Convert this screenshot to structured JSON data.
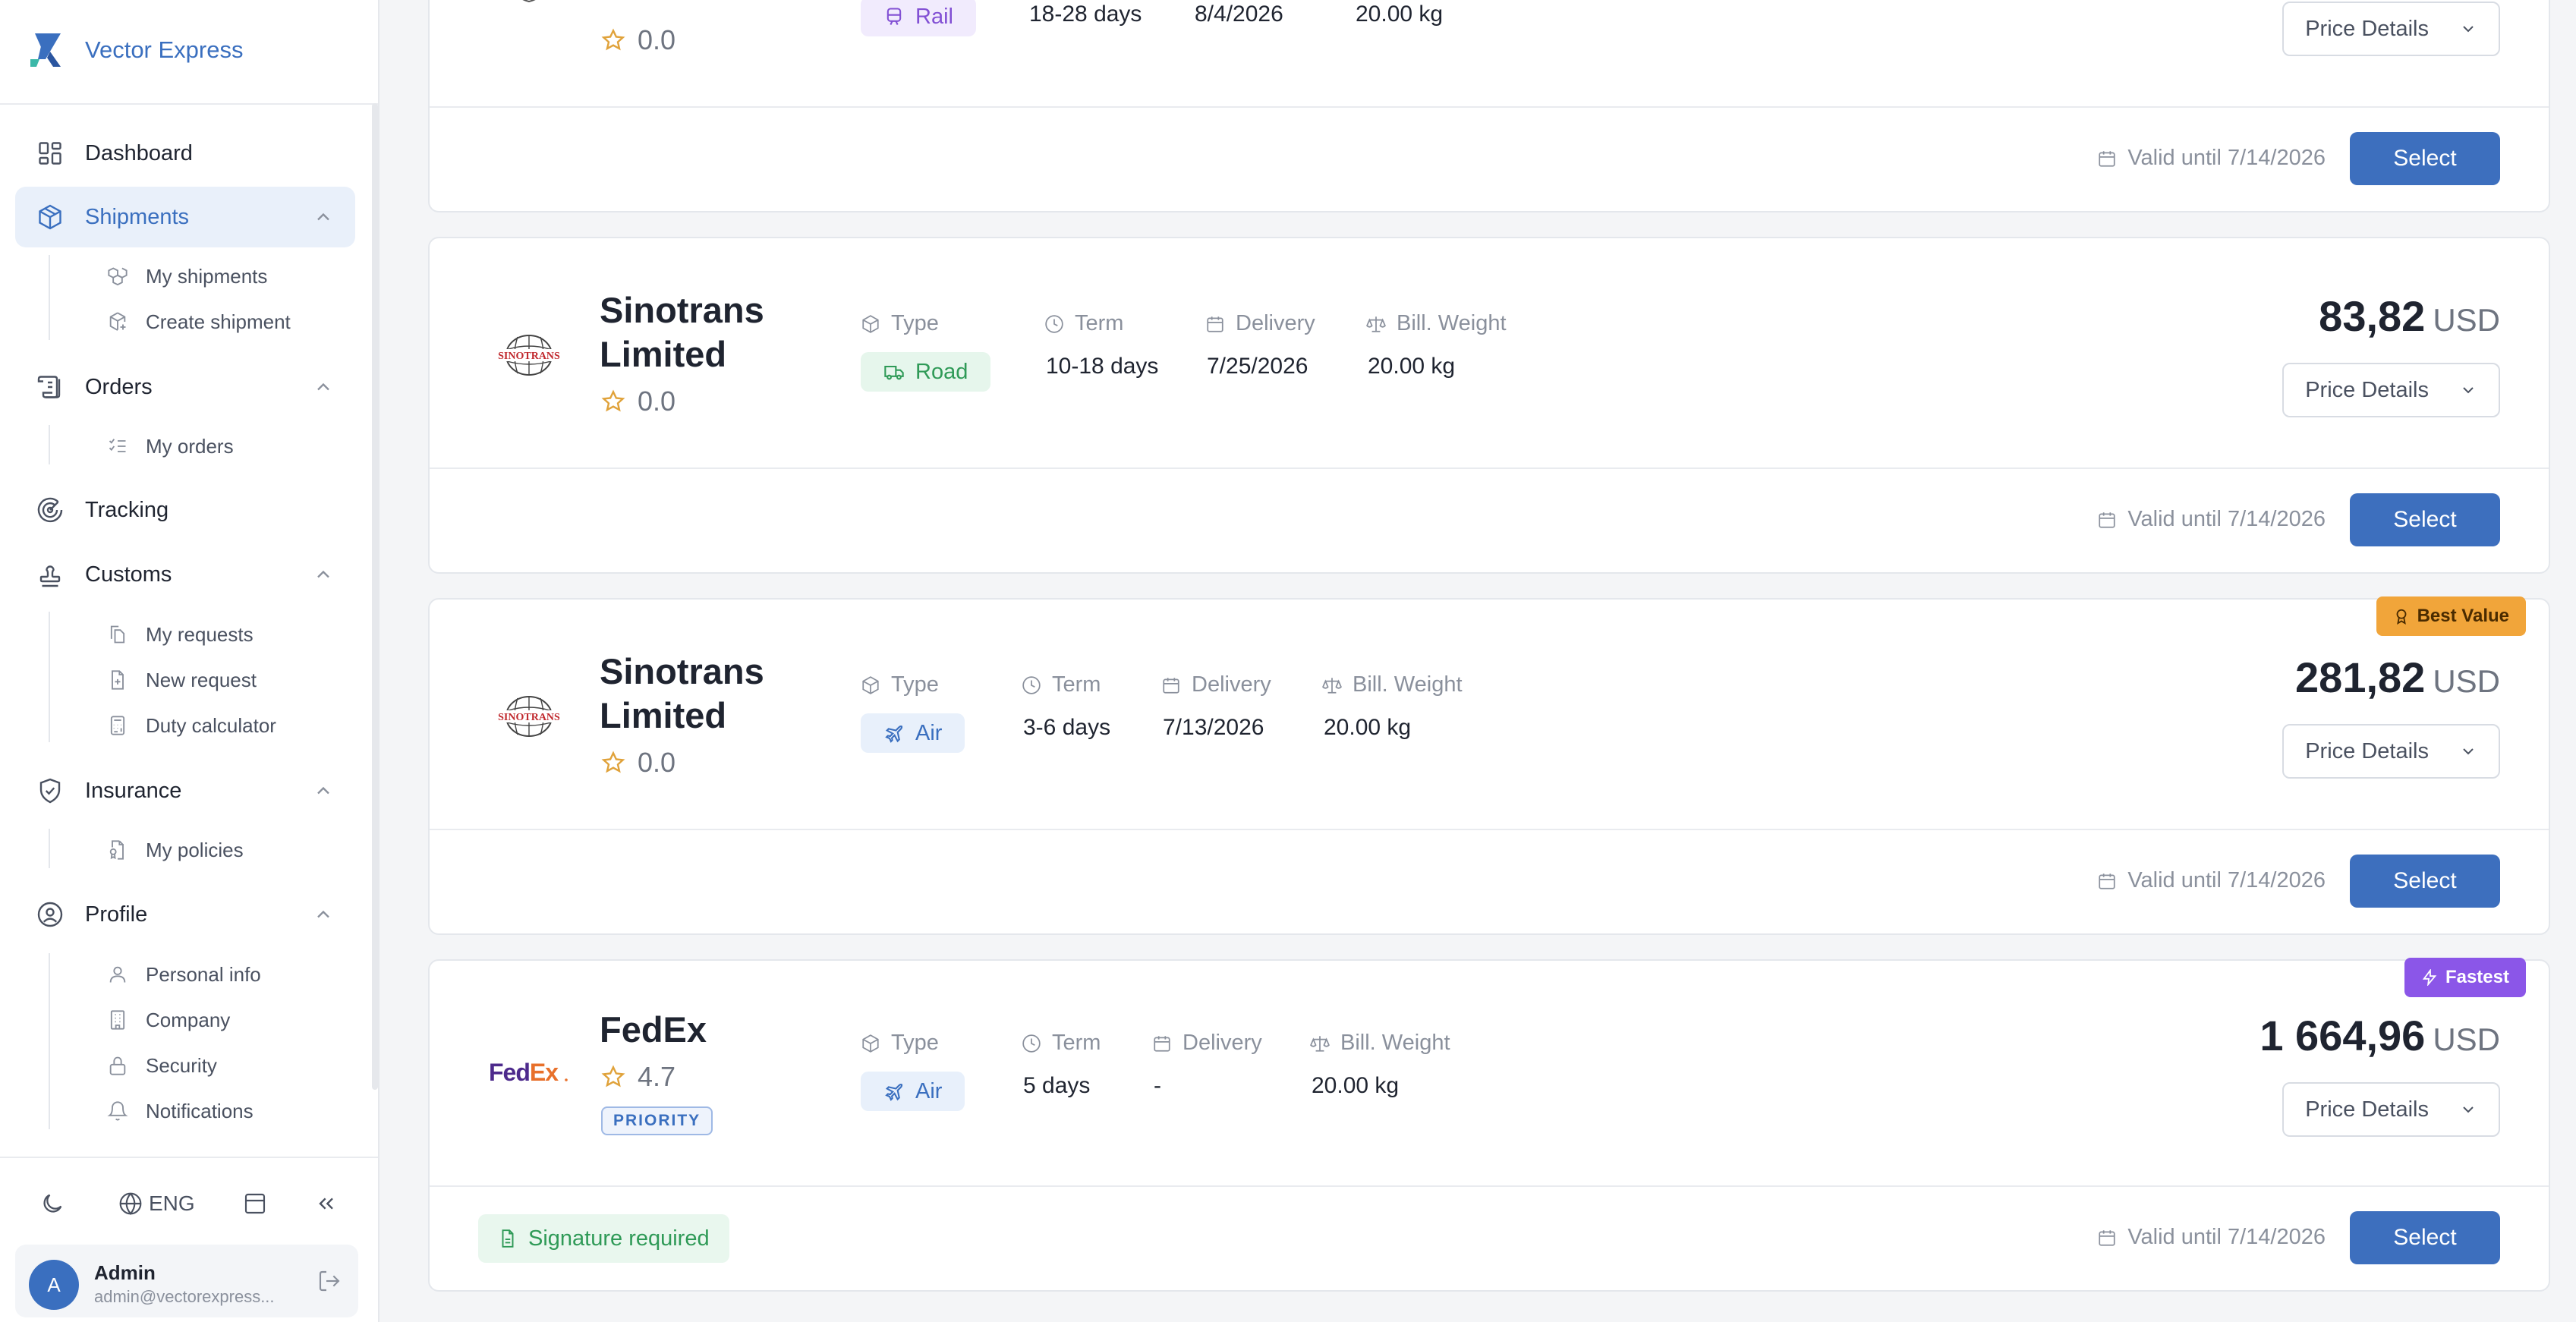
{
  "app": {
    "name": "Vector Express"
  },
  "sidebar": {
    "nav": [
      {
        "label": "Dashboard"
      },
      {
        "label": "Shipments",
        "sub": [
          "My shipments",
          "Create shipment"
        ]
      },
      {
        "label": "Orders",
        "sub": [
          "My orders"
        ]
      },
      {
        "label": "Tracking"
      },
      {
        "label": "Customs",
        "sub": [
          "My requests",
          "New request",
          "Duty calculator"
        ]
      },
      {
        "label": "Insurance",
        "sub": [
          "My policies"
        ]
      },
      {
        "label": "Profile",
        "sub": [
          "Personal info",
          "Company",
          "Security",
          "Notifications"
        ]
      }
    ],
    "language": "ENG",
    "user": {
      "initial": "A",
      "name": "Admin",
      "email": "admin@vectorexpress..."
    }
  },
  "labels": {
    "type": "Type",
    "term": "Term",
    "delivery": "Delivery",
    "weight": "Bill. Weight",
    "price_details": "Price Details",
    "select": "Select",
    "currency": "USD"
  },
  "quotes": [
    {
      "carrier": "Limited",
      "rating": "0.0",
      "type": "Rail",
      "term": "18-28 days",
      "delivery": "8/4/2026",
      "weight": "20.00 kg",
      "valid": "Valid until 7/14/2026"
    },
    {
      "carrier_line1": "Sinotrans",
      "carrier_line2": "Limited",
      "logo": "SINOTRANS",
      "rating": "0.0",
      "type": "Road",
      "term": "10-18 days",
      "delivery": "7/25/2026",
      "weight": "20.00 kg",
      "price": "83,82",
      "valid": "Valid until 7/14/2026"
    },
    {
      "carrier_line1": "Sinotrans",
      "carrier_line2": "Limited",
      "logo": "SINOTRANS",
      "rating": "0.0",
      "type": "Air",
      "term": "3-6 days",
      "delivery": "7/13/2026",
      "weight": "20.00 kg",
      "price": "281,82",
      "ribbon": "Best Value",
      "valid": "Valid until 7/14/2026"
    },
    {
      "carrier": "FedEx",
      "logo_a": "Fed",
      "logo_b": "Ex",
      "rating": "4.7",
      "badge": "PRIORITY",
      "type": "Air",
      "term": "5 days",
      "delivery": "-",
      "weight": "20.00 kg",
      "price": "1 664,96",
      "ribbon": "Fastest",
      "note": "Signature required",
      "valid": "Valid until 7/14/2026"
    }
  ],
  "colors": {
    "accent": "#3d6fbe",
    "rail": "#8250d4",
    "road": "#2f9a57",
    "air": "#3a6fbf",
    "best_value": "#f1a53a",
    "fastest": "#8b56e8"
  }
}
